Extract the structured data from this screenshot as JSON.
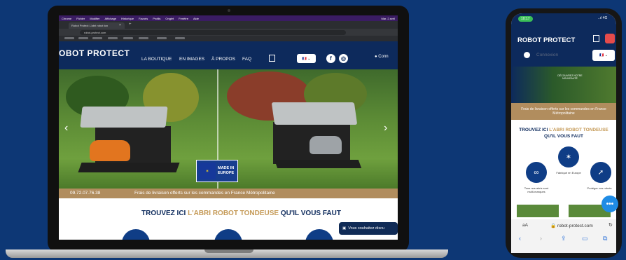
{
  "mac_menu": [
    "Chrome",
    "Fichier",
    "Modifier",
    "Affichage",
    "Historique",
    "Favoris",
    "Profils",
    "Onglet",
    "Fenêtre",
    "Aide"
  ],
  "mac_menu_right": "Mar. 2 avril",
  "browser": {
    "tab_title": "Robot Protect L'abri robot ton",
    "url": "robot-protect.com"
  },
  "site": {
    "logo": "ROBOT PROTECT",
    "logo_short": "OBOT PROTECT",
    "nav": [
      "LA BOUTIQUE",
      "EN IMAGES",
      "À PROPOS",
      "FAQ"
    ],
    "lang": "🇫🇷 ⌄",
    "user_label": "Conn",
    "phone": "09.72.07.76.38",
    "shipping": "Frais de livraison offerts sur les commandes en France Métropolitaine",
    "headline_pre": "TROUVEZ ICI ",
    "headline_accent": "L'ABRI ROBOT TONDEUSE",
    "headline_post": " QU'IL VOUS FAUT",
    "eu_badge_line1": "MADE IN",
    "eu_badge_line2": "EUROPE",
    "chat": "Vous souhaitez discu"
  },
  "phone_site": {
    "time": "10:17",
    "signal": "..ıl 4G",
    "logo": "ROBOT PROTECT",
    "connexion": "Connexion",
    "lang": "🇫🇷 ⌄",
    "banner_text": "DÉCOUVREZ NOTRE NOUVEAUTÉ",
    "shipping": "Frais de livraison offerts sur les commandes en France Métropolitaine",
    "headline_pre": "TROUVEZ ICI ",
    "headline_accent": "L'ABRI ROBOT TONDEUSE",
    "headline_post": " QU'IL VOUS FAUT",
    "icons": [
      {
        "icon": "infinity-icon",
        "caption": "Tous nos abris sont multi-marques"
      },
      {
        "icon": "eu-stars-icon",
        "caption": "Fabriqué en Europe"
      },
      {
        "icon": "rocket-icon",
        "caption": "Protéger vos robots"
      }
    ],
    "url_aa": "aA",
    "url": "🔒 robot-protect.com",
    "fab": "•••"
  },
  "colors": {
    "navy": "#0d2a5c",
    "accent_gold": "#c59a57",
    "background": "#0d3775",
    "fab_blue": "#1f8ce5"
  }
}
